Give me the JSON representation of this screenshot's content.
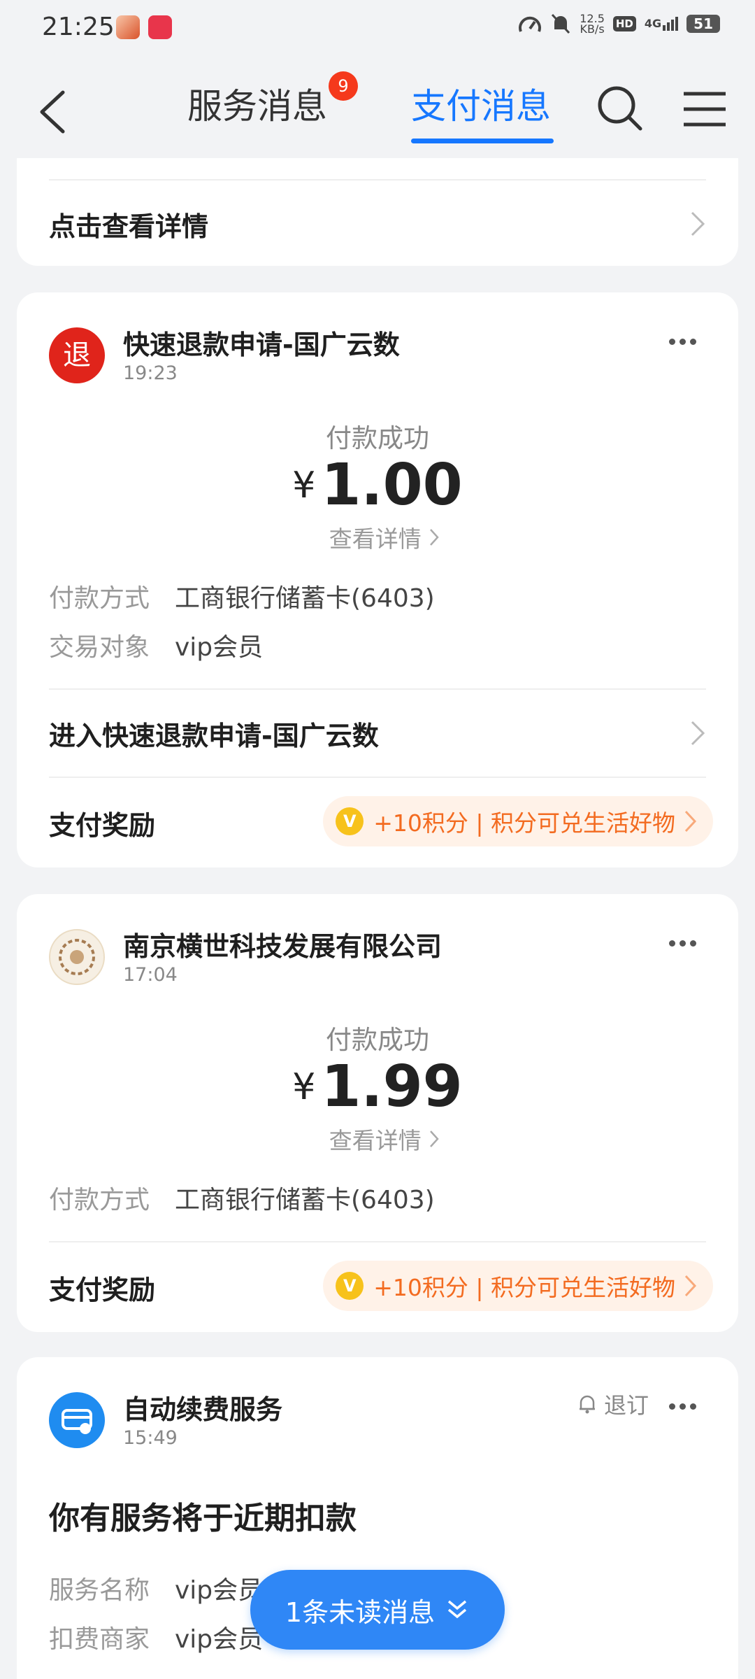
{
  "status_bar": {
    "time": "21:25",
    "speed": "12.5",
    "speed_unit": "KB/s",
    "hd": "HD",
    "network": "4G",
    "battery": "51"
  },
  "nav": {
    "tab_service": "服务消息",
    "service_badge": "9",
    "tab_pay": "支付消息"
  },
  "partial_card": {
    "link": "点击查看详情"
  },
  "card1": {
    "avatar_text": "退",
    "title": "快速退款申请-国广云数",
    "time": "19:23",
    "status": "付款成功",
    "currency": "¥",
    "amount": "1.00",
    "detail": "查看详情",
    "rows": [
      {
        "k": "付款方式",
        "v": "工商银行储蓄卡(6403)"
      },
      {
        "k": "交易对象",
        "v": "vip会员"
      }
    ],
    "link": "进入快速退款申请-国广云数",
    "reward_label": "支付奖励",
    "reward_text": "+10积分 | 积分可兑生活好物"
  },
  "card2": {
    "title": "南京横世科技发展有限公司",
    "time": "17:04",
    "status": "付款成功",
    "currency": "¥",
    "amount": "1.99",
    "detail": "查看详情",
    "rows": [
      {
        "k": "付款方式",
        "v": "工商银行储蓄卡(6403)"
      }
    ],
    "reward_label": "支付奖励",
    "reward_text": "+10积分 | 积分可兑生活好物"
  },
  "card3": {
    "title": "自动续费服务",
    "time": "15:49",
    "unsubscribe": "退订",
    "headline": "你有服务将于近期扣款",
    "rows": [
      {
        "k": "服务名称",
        "v": "vip会员自动续费"
      },
      {
        "k": "扣费商家",
        "v": "vip会员"
      }
    ]
  },
  "unread_button": "1条未读消息",
  "colors": {
    "accent": "#1677ff",
    "badge": "#f5391c",
    "reward": "#f36b20"
  }
}
